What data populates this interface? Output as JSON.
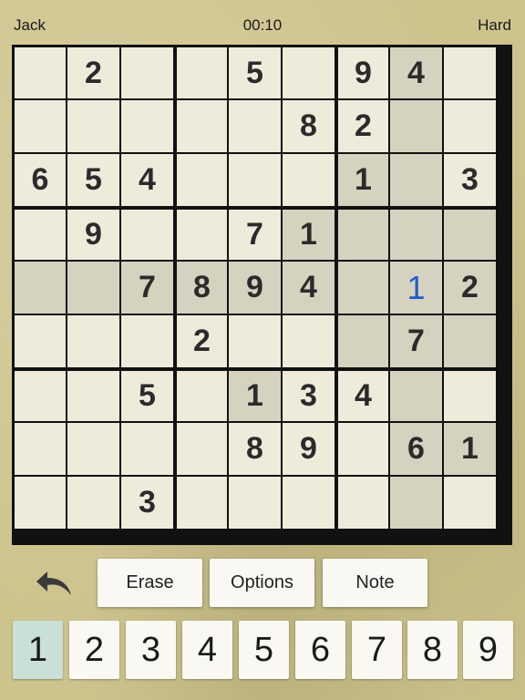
{
  "status": {
    "player": "Jack",
    "timer": "00:10",
    "difficulty": "Hard"
  },
  "board": {
    "rows": [
      [
        "",
        "2",
        "",
        "",
        "5",
        "",
        "9",
        "4",
        ""
      ],
      [
        "",
        "",
        "",
        "",
        "",
        "8",
        "2",
        "",
        ""
      ],
      [
        "6",
        "5",
        "4",
        "",
        "",
        "",
        "1",
        "",
        "3"
      ],
      [
        "",
        "9",
        "",
        "",
        "7",
        "1",
        "",
        "",
        ""
      ],
      [
        "",
        "",
        "7",
        "8",
        "9",
        "4",
        "",
        "1",
        "2"
      ],
      [
        "",
        "",
        "",
        "2",
        "",
        "",
        "",
        "7",
        ""
      ],
      [
        "",
        "",
        "5",
        "",
        "1",
        "3",
        "4",
        "",
        ""
      ],
      [
        "",
        "",
        "",
        "",
        "8",
        "9",
        "",
        "6",
        "1"
      ],
      [
        "",
        "",
        "3",
        "",
        "",
        "",
        "",
        "",
        ""
      ]
    ],
    "selected_cell": [
      4,
      7
    ],
    "user_entered_cells": [
      [
        4,
        7
      ]
    ],
    "highlighted_cells": [
      [
        0,
        7
      ],
      [
        1,
        7
      ],
      [
        2,
        6
      ],
      [
        2,
        7
      ],
      [
        3,
        5
      ],
      [
        3,
        6
      ],
      [
        3,
        7
      ],
      [
        3,
        8
      ],
      [
        4,
        0
      ],
      [
        4,
        1
      ],
      [
        4,
        2
      ],
      [
        4,
        3
      ],
      [
        4,
        4
      ],
      [
        4,
        5
      ],
      [
        4,
        6
      ],
      [
        4,
        7
      ],
      [
        4,
        8
      ],
      [
        5,
        6
      ],
      [
        5,
        7
      ],
      [
        5,
        8
      ],
      [
        6,
        4
      ],
      [
        6,
        7
      ],
      [
        7,
        7
      ],
      [
        7,
        8
      ],
      [
        8,
        7
      ]
    ],
    "colors": {
      "cell": "#efebdb",
      "highlight": "#d6d2c0",
      "given_digit": "#2b2b2b",
      "user_digit": "#1f5cc7",
      "grid_line": "#111111"
    }
  },
  "controls": {
    "undo_icon": "undo-arrow-icon",
    "erase_label": "Erase",
    "options_label": "Options",
    "note_label": "Note"
  },
  "keypad": {
    "keys": [
      "1",
      "2",
      "3",
      "4",
      "5",
      "6",
      "7",
      "8",
      "9"
    ],
    "selected": "1",
    "selected_color": "#c9e0d6"
  }
}
